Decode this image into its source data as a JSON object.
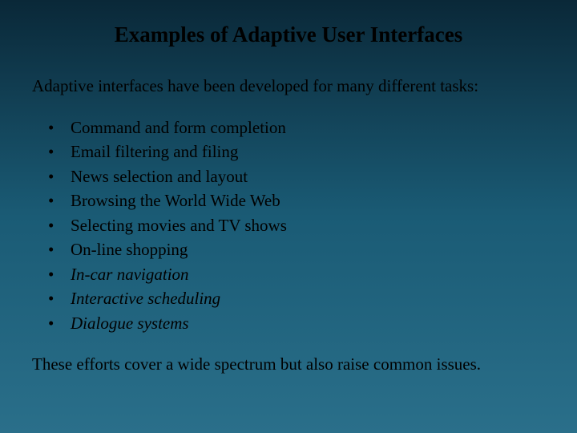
{
  "title": "Examples of Adaptive User Interfaces",
  "intro": "Adaptive interfaces have been developed for many different tasks:",
  "bullets": {
    "b0": "Command and form completion",
    "b1": "Email filtering and filing",
    "b2": "News selection and layout",
    "b3": "Browsing the World Wide Web",
    "b4": "Selecting movies and TV shows",
    "b5": "On-line shopping",
    "b6": "In-car navigation",
    "b7": "Interactive scheduling",
    "b8": "Dialogue systems"
  },
  "outro": "These efforts cover a wide spectrum but also raise common issues."
}
